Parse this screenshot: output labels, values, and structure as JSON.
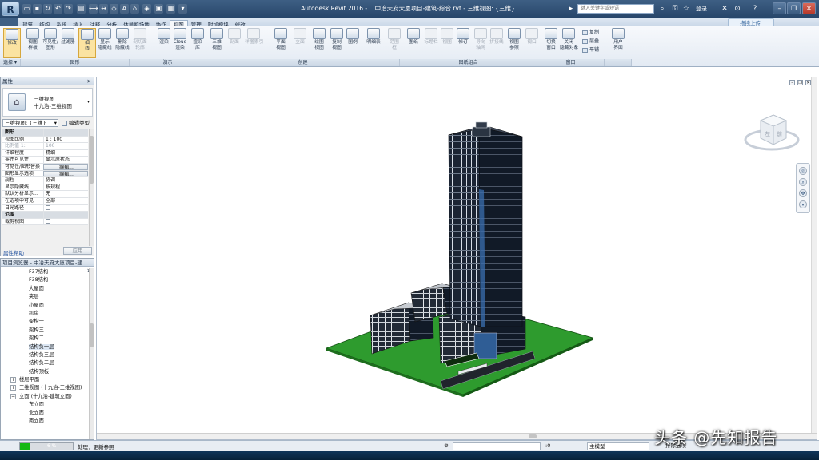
{
  "titlebar": {
    "app_logo": "R",
    "app_name": "Autodesk Revit 2016 -",
    "doc_title": "中冶天府大厦项目-建筑-综合.rvt - 三维视图: {三维}",
    "search_placeholder": "键入关键字或短语",
    "login": "登录",
    "help": "?",
    "x_icon": "✕"
  },
  "tabs": [
    "建筑",
    "结构",
    "系统",
    "插入",
    "注释",
    "分析",
    "体量和场地",
    "协作",
    "视图",
    "管理",
    "附加模块",
    "修改"
  ],
  "active_tab": "视图",
  "cloud_upload": "拖拽上传",
  "ribbon": {
    "select_label": "选择",
    "buttons": [
      {
        "label": "修改",
        "state": "sel"
      },
      {
        "label": "视图\n样板",
        "state": ""
      },
      {
        "label": "可见性/\n图形",
        "state": ""
      },
      {
        "label": "过滤器",
        "state": ""
      },
      {
        "label": "细\n线",
        "state": "sel"
      },
      {
        "label": "显示\n隐藏线",
        "state": ""
      },
      {
        "label": "删除\n隐藏线",
        "state": ""
      },
      {
        "label": "剖切面\n轮廓",
        "state": "dis"
      },
      {
        "label": "渲染",
        "state": ""
      },
      {
        "label": "Cloud\n渲染",
        "state": ""
      },
      {
        "label": "渲染\n库",
        "state": ""
      },
      {
        "label": "三维\n视图",
        "state": ""
      },
      {
        "label": "剖面",
        "state": "dis"
      },
      {
        "label": "详图索引",
        "state": "dis"
      },
      {
        "label": "平面\n视图",
        "state": ""
      },
      {
        "label": "立面",
        "state": "dis"
      },
      {
        "label": "绘图\n视图",
        "state": ""
      },
      {
        "label": "复制\n视图",
        "state": ""
      },
      {
        "label": "图例",
        "state": ""
      },
      {
        "label": "明细表",
        "state": ""
      },
      {
        "label": "范围\n框",
        "state": "dis"
      },
      {
        "label": "图纸",
        "state": ""
      },
      {
        "label": "标题栏",
        "state": "dis"
      },
      {
        "label": "视图",
        "state": "dis"
      },
      {
        "label": "修订",
        "state": ""
      },
      {
        "label": "导向\n轴网",
        "state": "dis"
      },
      {
        "label": "拼接线",
        "state": "dis"
      },
      {
        "label": "视图\n参照",
        "state": ""
      },
      {
        "label": "视口",
        "state": "dis"
      },
      {
        "label": "切换\n窗口",
        "state": ""
      },
      {
        "label": "关闭\n隐藏对象",
        "state": ""
      },
      {
        "label": "用户\n界面",
        "state": ""
      }
    ],
    "window_small": [
      "复制",
      "层叠",
      "平铺"
    ],
    "panels": [
      "选择 ▾",
      "图形",
      "演示",
      "创建",
      "图纸组合",
      "窗口",
      ""
    ]
  },
  "properties": {
    "title": "属性",
    "close": "✕",
    "type_name_1": "三维视图",
    "type_name_2": "十九治-三维视图",
    "view_selector": "三维视图: {三维}",
    "edit_type": "编辑类型",
    "rows": [
      {
        "k": "图形",
        "v": "",
        "kind": "grp"
      },
      {
        "k": "视图比例",
        "v": "1 : 100",
        "kind": ""
      },
      {
        "k": "比例值 1:",
        "v": "100",
        "kind": "dim"
      },
      {
        "k": "详细程度",
        "v": "精细",
        "kind": ""
      },
      {
        "k": "零件可见性",
        "v": "显示原状态",
        "kind": ""
      },
      {
        "k": "可见性/图形替换",
        "v": "编辑...",
        "kind": "btn"
      },
      {
        "k": "图形显示选项",
        "v": "编辑...",
        "kind": "btn"
      },
      {
        "k": "规程",
        "v": "协调",
        "kind": ""
      },
      {
        "k": "显示隐藏线",
        "v": "按规程",
        "kind": ""
      },
      {
        "k": "默认分析显示...",
        "v": "无",
        "kind": ""
      },
      {
        "k": "在选项中可见",
        "v": "全部",
        "kind": ""
      },
      {
        "k": "日光路径",
        "v": "",
        "kind": "chk"
      },
      {
        "k": "范围",
        "v": "",
        "kind": "grp"
      },
      {
        "k": "裁剪视图",
        "v": "",
        "kind": "chk"
      }
    ],
    "help_link": "属性帮助",
    "apply": "应用"
  },
  "browser": {
    "title": "项目浏览器 - 中冶天府大厦项目-建...",
    "leaves": [
      "F37结构",
      "F38结构",
      "大屋面",
      "夹层",
      "小屋面",
      "机房",
      "架构一",
      "架构三",
      "架构二",
      "结构负一层",
      "结构负三层",
      "结构负二层",
      "结构顶板"
    ],
    "selected_leaf": "结构负一层",
    "nodes": [
      {
        "toggle": "+",
        "label": "楼层平面"
      },
      {
        "toggle": "+",
        "label": "三维视图 (十九治-三维视图)"
      },
      {
        "toggle": "−",
        "label": "立面 (十九治-建筑立面)"
      }
    ],
    "elev_leaves": [
      "东立面",
      "北立面",
      "南立面"
    ]
  },
  "status": {
    "progress": 0.2,
    "progress_text": "6 %",
    "text": "处理：更新参照",
    "coord": ":0",
    "model": "主模型",
    "filter": "排除选项"
  },
  "watermark": "头条 @先知报告",
  "colors": {
    "ground": "#2e9b2e",
    "building": "#1b2433",
    "accent": "#14b814"
  }
}
